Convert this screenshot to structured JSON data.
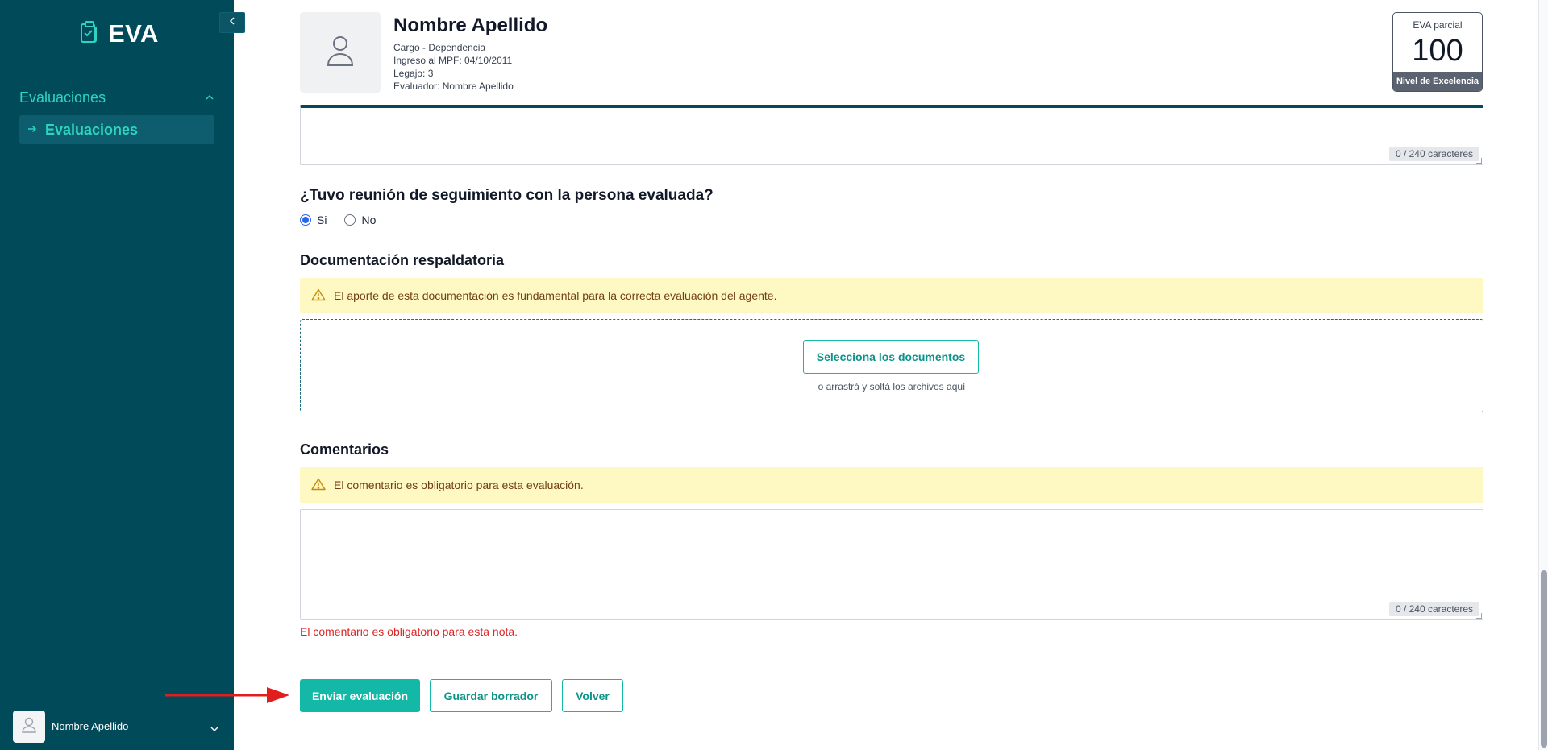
{
  "sidebar": {
    "logo_text": "EVA",
    "nav_section": "Evaluaciones",
    "nav_item": "Evaluaciones",
    "user_name": "Nombre Apellido"
  },
  "profile": {
    "name": "Nombre Apellido",
    "cargo": "Cargo - Dependencia",
    "ingreso": "Ingreso al MPF: 04/10/2011",
    "legajo": "Legajo: 3",
    "evaluador": "Evaluador: Nombre Apellido"
  },
  "score": {
    "label": "EVA parcial",
    "value": "100",
    "level": "Nivel de Excelencia"
  },
  "top_textarea": {
    "counter": "0 / 240 caracteres"
  },
  "followup": {
    "question": "¿Tuvo reunión de seguimiento con la persona evaluada?",
    "option_yes": "Si",
    "option_no": "No",
    "selected": "Si"
  },
  "documentation": {
    "title": "Documentación respaldatoria",
    "alert": "El aporte de esta documentación es fundamental para la correcta evaluación del agente.",
    "select_button": "Selecciona los documentos",
    "drop_hint": "o arrastrá y soltá los archivos aquí"
  },
  "comments": {
    "title": "Comentarios",
    "alert": "El comentario es obligatorio para esta evaluación.",
    "counter": "0 / 240 caracteres",
    "error": "El comentario es obligatorio para esta nota."
  },
  "actions": {
    "submit": "Enviar evaluación",
    "draft": "Guardar borrador",
    "back": "Volver"
  },
  "colors": {
    "sidebar_bg": "#004a5a",
    "accent": "#14b8a6",
    "alert_bg": "#fef9c3",
    "error": "#dc2626",
    "annotation_arrow": "#e11d1d"
  }
}
